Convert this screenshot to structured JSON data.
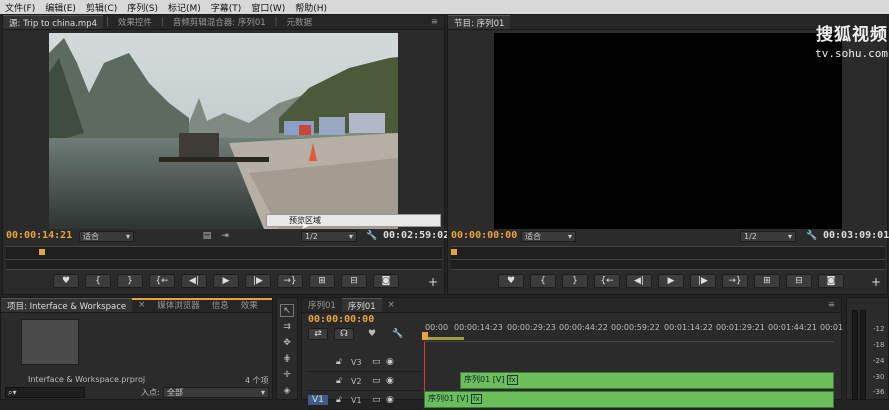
{
  "menu": [
    "文件(F)",
    "编辑(E)",
    "剪辑(C)",
    "序列(S)",
    "标记(M)",
    "字幕(T)",
    "窗口(W)",
    "帮助(H)"
  ],
  "source_panel": {
    "tabs": [
      "源: Trip to china.mp4",
      "效果控件",
      "音频剪辑混合器: 序列01",
      "元数据"
    ],
    "timecode_in": "00:00:14:21",
    "fit": "适合",
    "resolution": "1/2",
    "duration": "00:02:59:02",
    "context_popup": "预览区域"
  },
  "program_panel": {
    "tab": "节目: 序列01",
    "timecode_in": "00:00:00:00",
    "fit": "适合",
    "resolution": "1/2",
    "duration": "00:03:09:01"
  },
  "watermark": {
    "line1": "搜狐视频",
    "line2": "tv.sohu.com"
  },
  "transport_symbols": [
    "♥",
    "{",
    "}",
    "{←",
    "◀|",
    "▶",
    "|▶",
    "→}",
    "⊞",
    "⊟",
    "📷"
  ],
  "project_panel": {
    "tabs": [
      "项目: Interface & Workspace",
      "媒体浏览器",
      "信息",
      "效果"
    ],
    "project_file": "Interface & Workspace.prproj",
    "item_count": "4 个项",
    "entry_label": "入点:",
    "entry_value": "全部",
    "search_icon": "search-icon"
  },
  "timeline": {
    "tabs": [
      "序列01",
      "序列01"
    ],
    "timecode": "00:00:00:00",
    "ruler": [
      "00:00",
      "00:00:14:23",
      "00:00:29:23",
      "00:00:44:22",
      "00:00:59:22",
      "00:01:14:22",
      "00:01:29:21",
      "00:01:44:21",
      "00:01"
    ],
    "tracks": [
      "V3",
      "V2",
      "V1"
    ],
    "clip_v2": "序列01 [V]",
    "clip_v1": "序列01 [V]",
    "fx": "fx"
  },
  "meter_labels": [
    "-12",
    "-18",
    "-24",
    "-30",
    "-36"
  ],
  "colors": {
    "timecode": "#e8a33d",
    "clip": "#6bbf5a",
    "playhead": "#e8a33d"
  }
}
